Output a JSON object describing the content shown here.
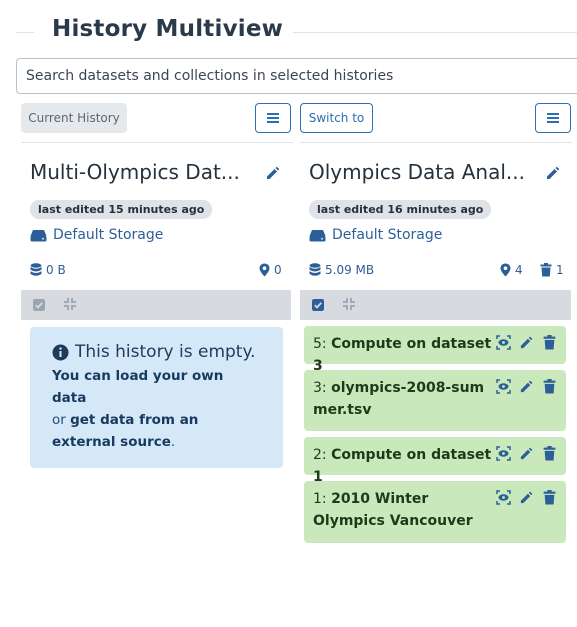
{
  "page": {
    "title": "History Multiview"
  },
  "search": {
    "placeholder": "Search datasets and collections in selected histories"
  },
  "toolbar": {
    "current_history_label": "Current History",
    "switch_to_label": "Switch to"
  },
  "histories": [
    {
      "name": "Multi-Olympics Dat...",
      "last_edited": "last edited 15 minutes ago",
      "storage": "Default Storage",
      "size": "0 B",
      "count_shown": "0",
      "empty_message": {
        "title": "This history is empty.",
        "line1": "You can load your own data",
        "line2_prefix": "or",
        "line2_link": "get data from an external source",
        "line2_suffix": "."
      }
    },
    {
      "name": "Olympics Data Anal...",
      "last_edited": "last edited 16 minutes ago",
      "storage": "Default Storage",
      "size": "5.09 MB",
      "count_shown": "4",
      "count_deleted": "1",
      "items": [
        {
          "hid": "5:",
          "name": "Compute on dataset 3"
        },
        {
          "hid": "3:",
          "name": "olympics-2008-summer.tsv"
        },
        {
          "hid": "2:",
          "name": "Compute on dataset 1"
        },
        {
          "hid": "1:",
          "name": "2010 Winter Olympics Vancouver"
        }
      ]
    }
  ],
  "colors": {
    "accent": "#2c6fb3",
    "ok_state": "#c9e9bc",
    "info_box": "#d5e8f7"
  }
}
